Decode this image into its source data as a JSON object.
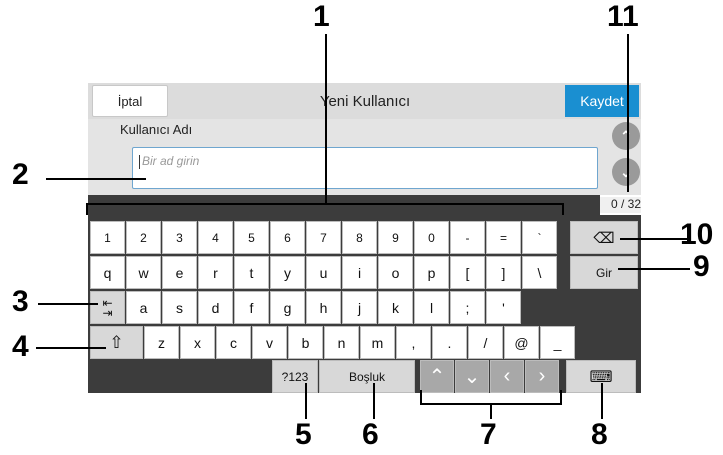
{
  "header": {
    "cancel": "İptal",
    "title": "Yeni Kullanıcı",
    "save": "Kaydet"
  },
  "field": {
    "label": "Kullanıcı Adı",
    "placeholder": "Bir ad girin",
    "counter": "0 / 32"
  },
  "keyboard": {
    "row1": [
      "1",
      "2",
      "3",
      "4",
      "5",
      "6",
      "7",
      "8",
      "9",
      "0",
      "-",
      "=",
      "`"
    ],
    "row2": [
      "q",
      "w",
      "e",
      "r",
      "t",
      "y",
      "u",
      "i",
      "o",
      "p",
      "[",
      "]",
      "\\"
    ],
    "row3": [
      "a",
      "s",
      "d",
      "f",
      "g",
      "h",
      "j",
      "k",
      "l",
      ";",
      "'"
    ],
    "row4": [
      "z",
      "x",
      "c",
      "v",
      "b",
      "n",
      "m",
      ",",
      ".",
      "/",
      "@",
      "_"
    ],
    "enter": "Gir",
    "numeric": "?123",
    "space": "Boşluk"
  },
  "callouts": [
    "1",
    "2",
    "3",
    "4",
    "5",
    "6",
    "7",
    "8",
    "9",
    "10",
    "11"
  ],
  "icons": {
    "backspace": "backspace-icon",
    "tab": "tab-icon",
    "shift": "shift-icon",
    "keyboard": "keyboard-icon",
    "up": "chevron-up-icon",
    "down": "chevron-down-icon",
    "left": "chevron-left-icon",
    "right": "chevron-right-icon"
  }
}
